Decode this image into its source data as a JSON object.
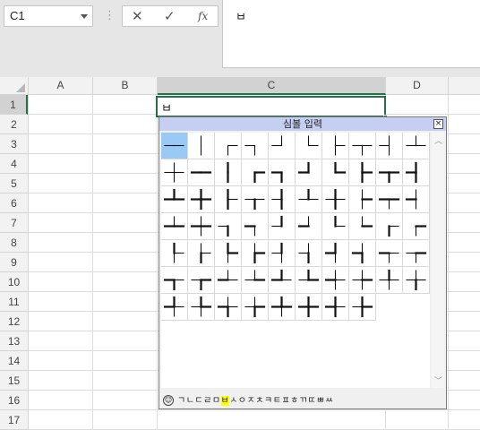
{
  "formula_bar": {
    "name_box": "C1",
    "cancel_icon": "✕",
    "enter_icon": "✓",
    "fx_label": "fx",
    "formula_value": "ㅂ"
  },
  "columns": [
    "A",
    "B",
    "C",
    "D"
  ],
  "rows": [
    "1",
    "2",
    "3",
    "4",
    "5",
    "6",
    "7",
    "8",
    "9",
    "10",
    "11",
    "12",
    "13",
    "14",
    "15",
    "16",
    "17"
  ],
  "active_cell": {
    "ref": "C1",
    "value": "ㅂ"
  },
  "symbol_popup": {
    "title": "심볼 입력",
    "close_label": "×",
    "selected_index": 0,
    "symbols": [
      "─",
      "│",
      "┌",
      "┐",
      "┘",
      "└",
      "├",
      "┬",
      "┤",
      "┴",
      "┼",
      "━",
      "┃",
      "┏",
      "┓",
      "┛",
      "┗",
      "┣",
      "┳",
      "┫",
      "┻",
      "╋",
      "┠",
      "┯",
      "┨",
      "┷",
      "┿",
      "┝",
      "┰",
      "┥",
      "┸",
      "╂",
      "┒",
      "┑",
      "┚",
      "┙",
      "┖",
      "┕",
      "┎",
      "┍",
      "┞",
      "┟",
      "┡",
      "┢",
      "┦",
      "┧",
      "┩",
      "┪",
      "┭",
      "┮",
      "┱",
      "┲",
      "┵",
      "┶",
      "┹",
      "┺",
      "┽",
      "┾",
      "╀",
      "╁",
      "╃",
      "╄",
      "╅",
      "╆",
      "╇",
      "╈",
      "╉",
      "╊"
    ],
    "footer_smiley": "☺",
    "footer_jamo": [
      "ㄱ",
      "ㄴ",
      "ㄷ",
      "ㄹ",
      "ㅁ",
      "ㅂ",
      "ㅅ",
      "ㅇ",
      "ㅈ",
      "ㅊ",
      "ㅋ",
      "ㅌ",
      "ㅍ",
      "ㅎ",
      "ㄲ",
      "ㄸ",
      "ㅃ",
      "ㅆ"
    ],
    "footer_selected": "ㅂ"
  }
}
